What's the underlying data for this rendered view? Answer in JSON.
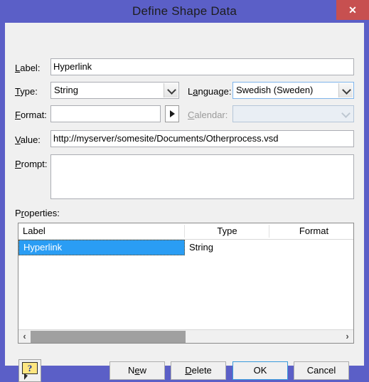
{
  "window": {
    "title": "Define Shape Data",
    "close_label": "✕",
    "accent_titlebar": "#5b5fc7",
    "close_color": "#c75050",
    "client_bg": "#f0f0f0"
  },
  "form": {
    "label_field": {
      "label_prefix": "",
      "label_accel": "L",
      "label_rest": "abel:",
      "value": "Hyperlink"
    },
    "type_field": {
      "label_accel": "T",
      "label_rest": "ype:",
      "value": "String"
    },
    "language_field": {
      "label_prefix": "L",
      "label_accel": "a",
      "label_rest": "nguage:",
      "value": "Swedish (Sweden)"
    },
    "format_field": {
      "label_accel": "F",
      "label_rest": "ormat:",
      "value": "",
      "arrow_glyph": "▶"
    },
    "calendar_field": {
      "label_accel": "C",
      "label_rest": "alendar:",
      "value": "",
      "disabled": true
    },
    "value_field": {
      "label_accel": "V",
      "label_rest": "alue:",
      "value": "http://myserver/somesite/Documents/Otherprocess.vsd"
    },
    "prompt_field": {
      "label_accel": "P",
      "label_rest": "rompt:",
      "value": ""
    }
  },
  "properties": {
    "section_label_prefix": "P",
    "section_label_accel": "r",
    "section_label_rest": "operties:",
    "columns": [
      "Label",
      "Type",
      "Format"
    ],
    "rows": [
      {
        "label": "Hyperlink",
        "type": "String",
        "format": "",
        "selected": true
      }
    ],
    "selection_color": "#2a9df4",
    "scrollbar": {
      "left_glyph": "‹",
      "right_glyph": "›",
      "thumb_color": "#a0a0a0"
    }
  },
  "buttons": {
    "new": {
      "prefix": "N",
      "accel": "e",
      "rest": "w"
    },
    "delete": {
      "prefix": "",
      "accel": "D",
      "rest": "elete"
    },
    "ok": {
      "label": "OK",
      "is_default": true
    },
    "cancel": {
      "label": "Cancel"
    },
    "help": {
      "glyph": "?"
    }
  }
}
